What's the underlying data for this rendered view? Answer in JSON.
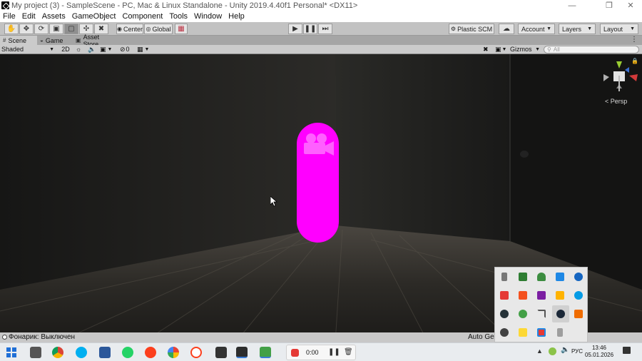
{
  "window": {
    "title": "My project (3) - SampleScene - PC, Mac & Linux Standalone - Unity 2019.4.40f1 Personal* <DX11>",
    "controls": [
      "minimize-icon",
      "restore-icon",
      "close-icon"
    ]
  },
  "menu": [
    "File",
    "Edit",
    "Assets",
    "GameObject",
    "Component",
    "Tools",
    "Window",
    "Help"
  ],
  "toolbar": {
    "pivot_label": "Center",
    "space_label": "Global",
    "plastic_label": "Plastic SCM",
    "account_label": "Account",
    "layers_label": "Layers",
    "layout_label": "Layout"
  },
  "tabs": [
    {
      "label": "Scene",
      "icon": "hashtag-icon",
      "active": true
    },
    {
      "label": "Game",
      "icon": "pacman-icon",
      "active": false
    },
    {
      "label": "Asset Store",
      "icon": "bag-icon",
      "active": false
    }
  ],
  "scene_toolbar": {
    "draw_mode": "Shaded",
    "mode_2d": "2D",
    "hidden_count": "0",
    "gizmos_label": "Gizmos",
    "search_placeholder": "All"
  },
  "viewport": {
    "projection_label": "< Persp",
    "capsule_color": "#ff00ff"
  },
  "status": {
    "message": "Фонарик: Выключен",
    "auto_generate": "Auto Generate Lighting On"
  },
  "taskbar": {
    "recorder_time": "0:00",
    "language": "РУС",
    "time": "13:46",
    "date": "05.01.2026"
  }
}
